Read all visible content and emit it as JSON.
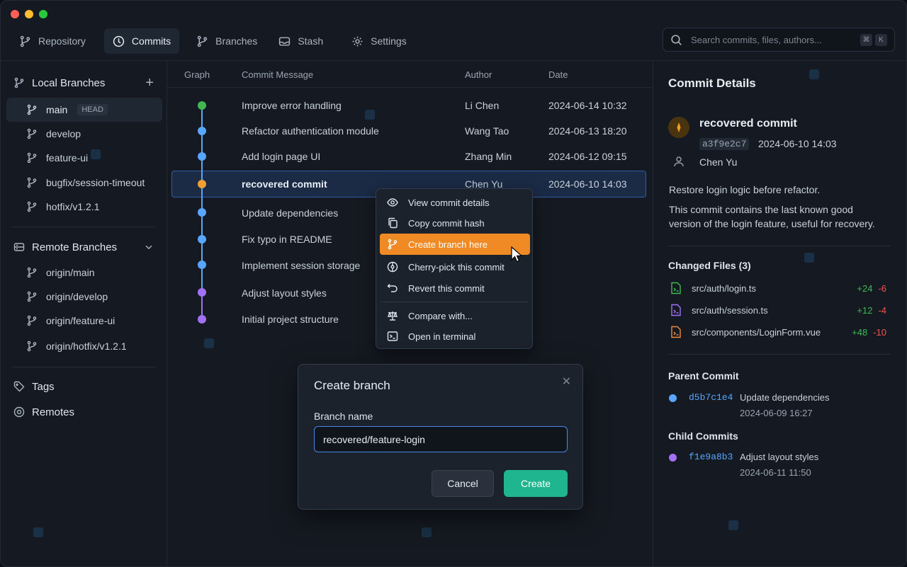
{
  "colors": {
    "accent": "#f08a24",
    "primary": "#1fb58f",
    "selection": "#1b2b45",
    "link": "#58a6ff",
    "additions": "#3fb950",
    "deletions": "#f85149"
  },
  "window_controls": [
    "close",
    "minimize",
    "maximize"
  ],
  "nav": {
    "tabs": [
      {
        "label": "Repository",
        "icon": "branch-icon"
      },
      {
        "label": "Commits",
        "icon": "clock-icon",
        "active": true
      },
      {
        "label": "Branches",
        "icon": "branch-icon"
      },
      {
        "label": "Stash",
        "icon": "inbox-icon"
      },
      {
        "label": "Settings",
        "icon": "gear-icon"
      }
    ]
  },
  "search": {
    "placeholder": "Search commits, files, authors...",
    "shortcut": [
      "⌘",
      "K"
    ]
  },
  "sidebar": {
    "local_title": "Local Branches",
    "local_branches": [
      "main",
      "develop",
      "feature-ui",
      "bugfix/session-timeout",
      "hotfix/v1.2.1"
    ],
    "head_badge": "HEAD",
    "remote_title": "Remote Branches",
    "remote_branches": [
      "origin/main",
      "origin/develop",
      "origin/feature-ui",
      "origin/hotfix/v1.2.1"
    ],
    "tags_label": "Tags",
    "remotes_label": "Remotes"
  },
  "commits": {
    "headers": {
      "graph": "Graph",
      "message": "Commit Message",
      "author": "Author",
      "date": "Date"
    },
    "rows": [
      {
        "message": "Improve error handling",
        "author": "Li Chen",
        "date": "2024-06-14  10:32",
        "color": "#3fb950"
      },
      {
        "message": "Refactor authentication module",
        "author": "Wang Tao",
        "date": "2024-06-13  18:20",
        "color": "#58a6ff"
      },
      {
        "message": "Add login page UI",
        "author": "Zhang Min",
        "date": "2024-06-12  09:15",
        "color": "#58a6ff"
      },
      {
        "message": "recovered commit",
        "author": "Chen Yu",
        "date": "2024-06-10  14:03",
        "color": "#f0a030",
        "selected": true
      },
      {
        "message": "Update dependencies",
        "author": "",
        "date": "",
        "color": "#58a6ff"
      },
      {
        "message": "Fix typo in README",
        "author": "",
        "date": "",
        "color": "#58a6ff"
      },
      {
        "message": "Implement session storage",
        "author": "",
        "date": "",
        "color": "#58a6ff"
      },
      {
        "message": "Adjust layout styles",
        "author": "",
        "date": "",
        "color": "#a371f7"
      },
      {
        "message": "Initial project structure",
        "author": "",
        "date": "",
        "color": "#a371f7"
      }
    ]
  },
  "context_menu": {
    "items": [
      {
        "label": "View commit details",
        "icon": "eye-icon"
      },
      {
        "label": "Copy commit hash",
        "icon": "copy-icon"
      },
      {
        "label": "Create branch here",
        "icon": "branch-icon",
        "highlighted": true
      },
      {
        "label": "Cherry-pick this commit",
        "icon": "cherry-pick-icon"
      },
      {
        "label": "Revert this commit",
        "icon": "undo-icon"
      },
      {
        "label": "Compare with...",
        "icon": "scale-icon"
      },
      {
        "label": "Open in terminal",
        "icon": "terminal-icon"
      }
    ]
  },
  "dialog": {
    "title": "Create branch",
    "field_label": "Branch name",
    "field_value": "recovered/feature-login",
    "cancel_label": "Cancel",
    "create_label": "Create"
  },
  "details": {
    "title": "Commit Details",
    "commit_title": "recovered commit",
    "hash": "a3f9e2c7",
    "date": "2024-06-10  14:03",
    "author": "Chen Yu",
    "summary": "Restore login logic before refactor.",
    "body_line1": "This commit contains the last known good",
    "body_line2": "version of the login feature, useful for recovery.",
    "changed_title": "Changed Files (3)",
    "files": [
      {
        "name": "src/auth/login.ts",
        "add": "+24",
        "del": "-6",
        "color": "#3fb950"
      },
      {
        "name": "src/auth/session.ts",
        "add": "+12",
        "del": "-4",
        "color": "#a371f7"
      },
      {
        "name": "src/components/LoginForm.vue",
        "add": "+48",
        "del": "-10",
        "color": "#f0883e"
      }
    ],
    "parent_title": "Parent Commit",
    "parent": {
      "hash": "d5b7c1e4",
      "message": "Update dependencies",
      "date": "2024-06-09 16:27"
    },
    "child_title": "Child Commits",
    "child": {
      "hash": "f1e9a8b3",
      "message": "Adjust layout styles",
      "date": "2024-06-11 11:50"
    }
  }
}
